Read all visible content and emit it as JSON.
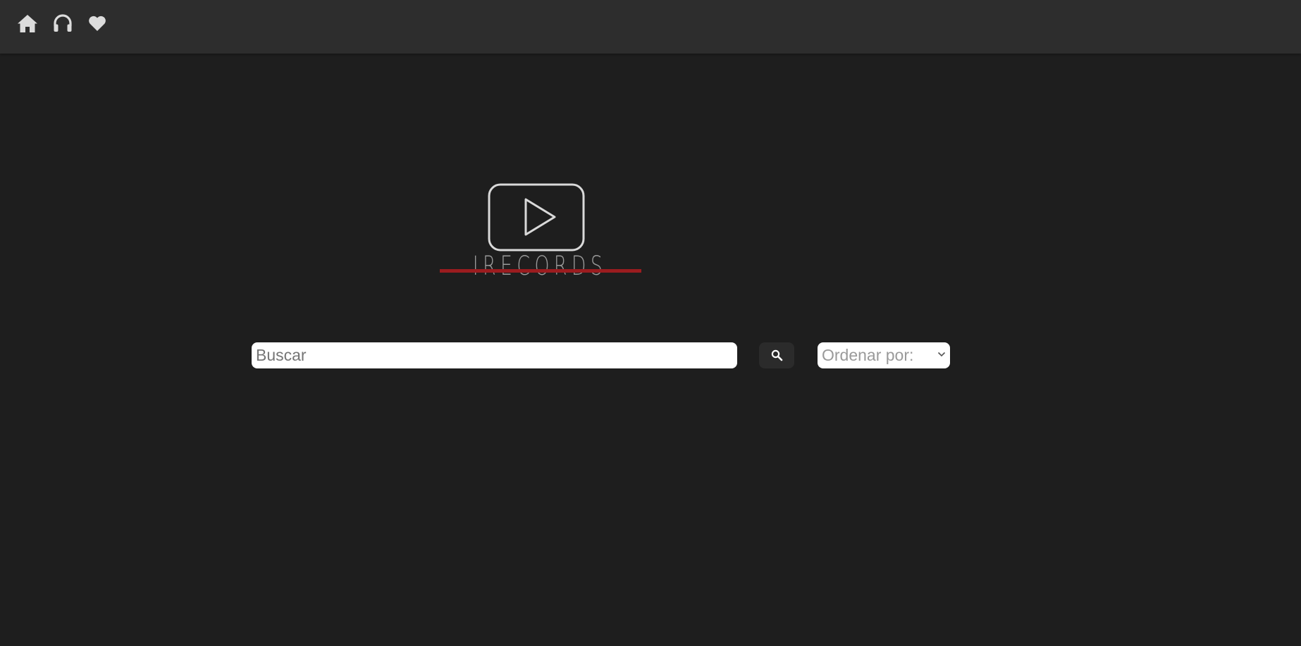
{
  "nav": {
    "icons": [
      "home-icon",
      "headphones-icon",
      "heart-icon"
    ],
    "icon_color": "#dcdcdc"
  },
  "logo": {
    "text": "IRECORDS",
    "line_color": "#9b1c1f",
    "frame_color": "#d9d9d9"
  },
  "search": {
    "placeholder": "Buscar",
    "value": ""
  },
  "sort": {
    "selected_label": "Ordenar por:"
  },
  "colors": {
    "background": "#1e1e1e",
    "topbar": "#2d2d2d",
    "button": "#2b2b2b"
  }
}
